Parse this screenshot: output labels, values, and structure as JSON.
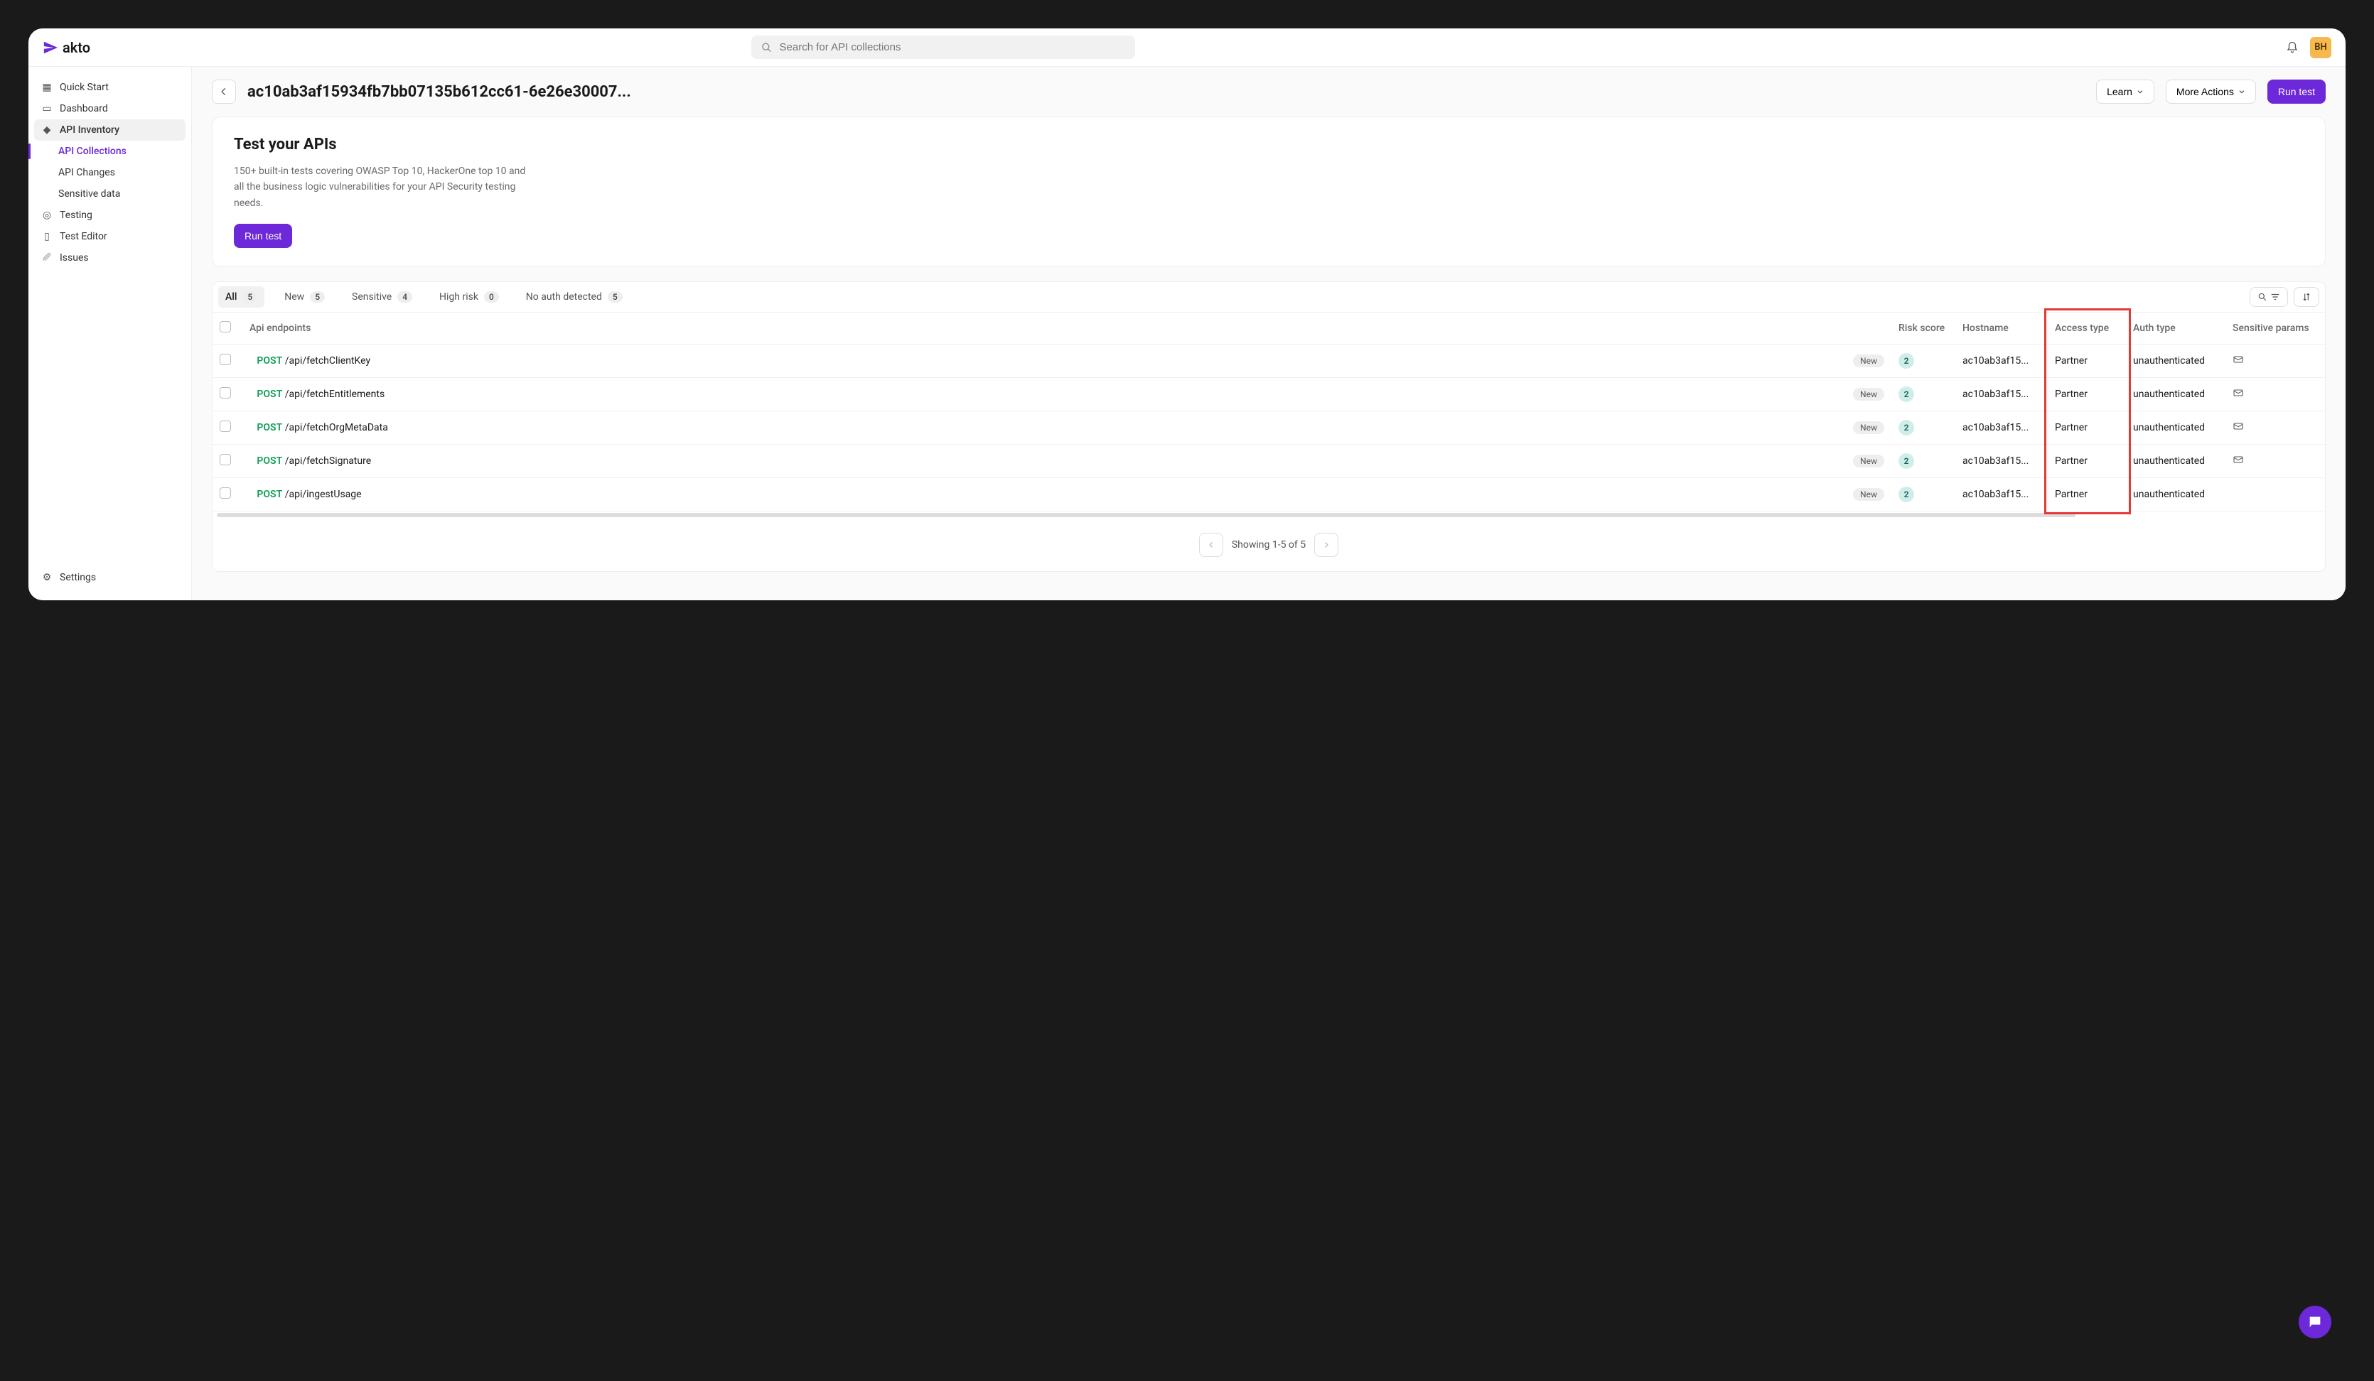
{
  "brand": "akto",
  "search": {
    "placeholder": "Search for API collections"
  },
  "user": {
    "initials": "BH"
  },
  "sidebar": {
    "items": [
      {
        "label": "Quick Start"
      },
      {
        "label": "Dashboard"
      },
      {
        "label": "API Inventory"
      },
      {
        "label": "API Collections"
      },
      {
        "label": "API Changes"
      },
      {
        "label": "Sensitive data"
      },
      {
        "label": "Testing"
      },
      {
        "label": "Test Editor"
      },
      {
        "label": "Issues"
      }
    ],
    "settings": "Settings"
  },
  "header": {
    "title": "ac10ab3af15934fb7bb07135b612cc61-6e26e30007...",
    "learn": "Learn",
    "more": "More Actions",
    "run": "Run test"
  },
  "intro": {
    "heading": "Test your APIs",
    "body": "150+ built-in tests covering OWASP Top 10, HackerOne top 10 and all the business logic vulnerabilities for your API Security testing needs.",
    "cta": "Run test"
  },
  "tabs": [
    {
      "label": "All",
      "count": "5"
    },
    {
      "label": "New",
      "count": "5"
    },
    {
      "label": "Sensitive",
      "count": "4"
    },
    {
      "label": "High risk",
      "count": "0"
    },
    {
      "label": "No auth detected",
      "count": "5"
    }
  ],
  "columns": {
    "endpoints": "Api endpoints",
    "risk": "Risk score",
    "hostname": "Hostname",
    "access": "Access type",
    "auth": "Auth type",
    "sensitive": "Sensitive params"
  },
  "rows": [
    {
      "method": "POST",
      "path": "/api/fetchClientKey",
      "new": "New",
      "risk": "2",
      "hostname": "ac10ab3af15...",
      "access": "Partner",
      "auth": "unauthenticated",
      "sensitive_icon": true
    },
    {
      "method": "POST",
      "path": "/api/fetchEntitlements",
      "new": "New",
      "risk": "2",
      "hostname": "ac10ab3af15...",
      "access": "Partner",
      "auth": "unauthenticated",
      "sensitive_icon": true
    },
    {
      "method": "POST",
      "path": "/api/fetchOrgMetaData",
      "new": "New",
      "risk": "2",
      "hostname": "ac10ab3af15...",
      "access": "Partner",
      "auth": "unauthenticated",
      "sensitive_icon": true
    },
    {
      "method": "POST",
      "path": "/api/fetchSignature",
      "new": "New",
      "risk": "2",
      "hostname": "ac10ab3af15...",
      "access": "Partner",
      "auth": "unauthenticated",
      "sensitive_icon": true
    },
    {
      "method": "POST",
      "path": "/api/ingestUsage",
      "new": "New",
      "risk": "2",
      "hostname": "ac10ab3af15...",
      "access": "Partner",
      "auth": "unauthenticated",
      "sensitive_icon": false
    }
  ],
  "pagination": "Showing 1-5 of 5"
}
